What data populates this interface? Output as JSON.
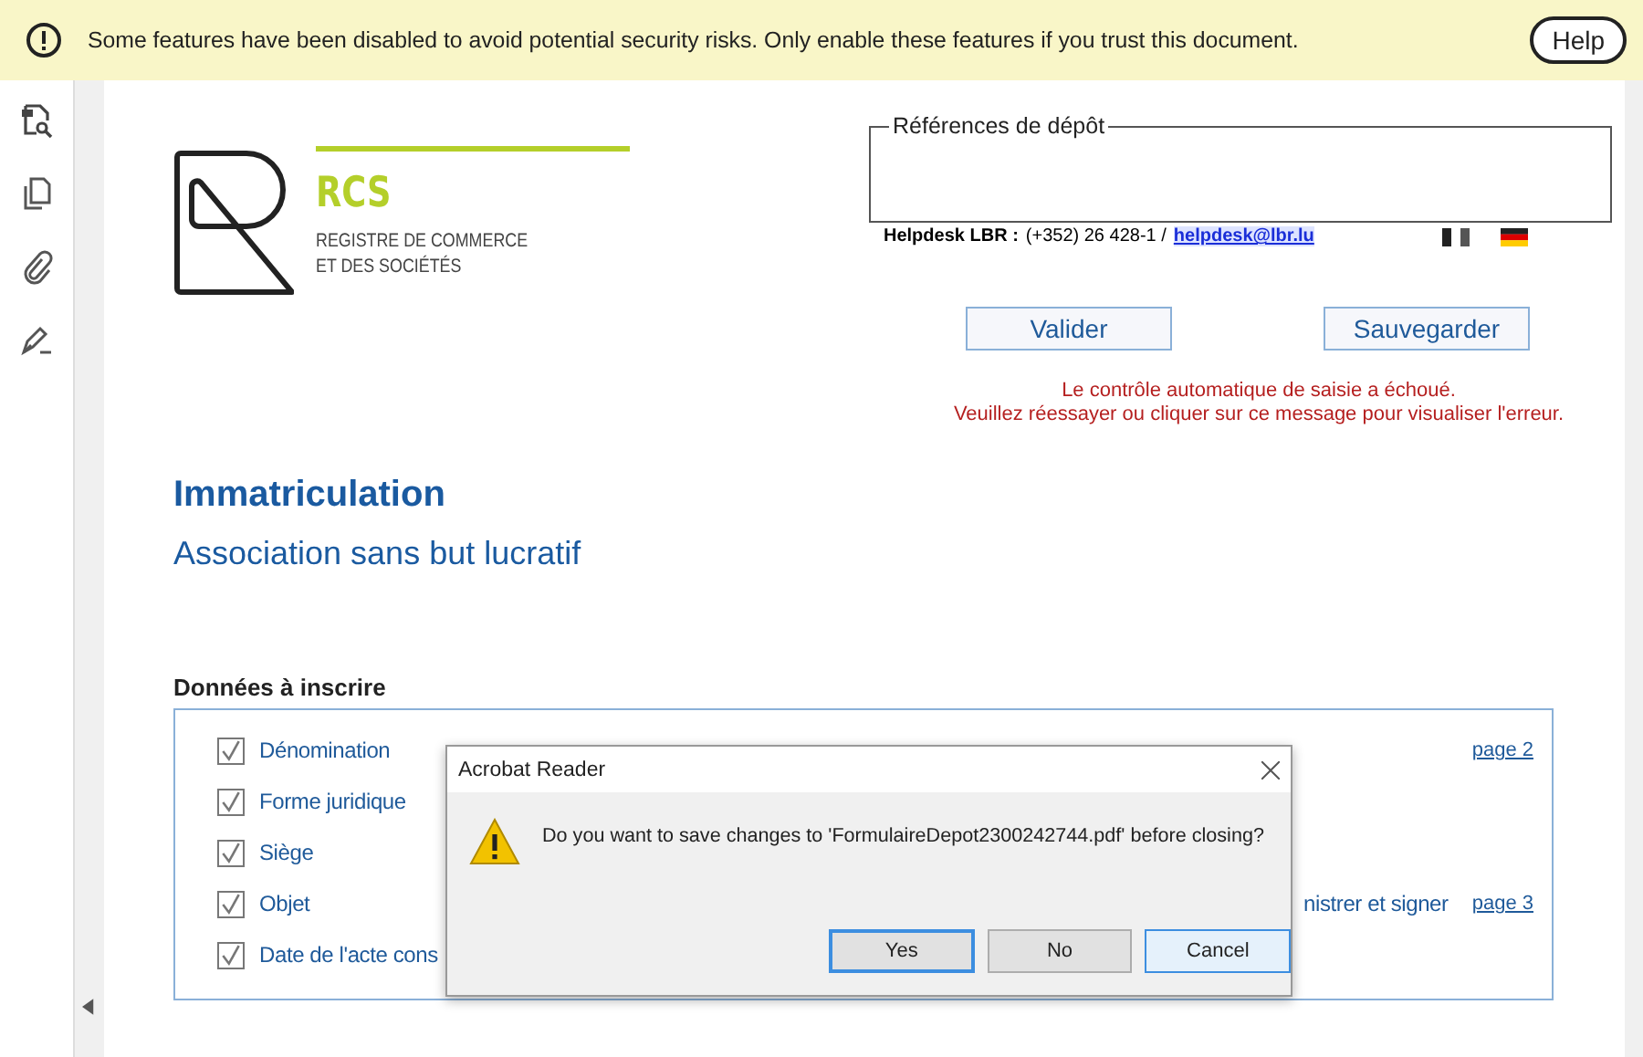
{
  "security_bar": {
    "message": "Some features have been disabled to avoid potential security risks. Only enable these features if you trust this document.",
    "help_button": "Help"
  },
  "document": {
    "logo": {
      "acronym": "RCS",
      "line_1": "REGISTRE DE COMMERCE",
      "line_2": "ET DES SOCIÉTÉS"
    },
    "references": {
      "legend": "Références de dépôt"
    },
    "helpdesk": {
      "label": "Helpdesk LBR :",
      "phone": "(+352) 26 428-1  /",
      "email": "helpdesk@lbr.lu"
    },
    "buttons": [
      "Valider",
      "Sauvegarder"
    ],
    "error_lines": [
      "Le contrôle automatique de saisie a échoué.",
      "Veuillez réessayer ou cliquer sur ce message pour visualiser l'erreur."
    ],
    "title": "Immatriculation",
    "subtitle": "Association sans but lucratif",
    "section": {
      "heading": "Données à inscrire",
      "items": [
        {
          "label": "Dénomination",
          "checked": true,
          "page_link": "page 2"
        },
        {
          "label": "Forme juridique",
          "checked": true
        },
        {
          "label": "Siège",
          "checked": true
        },
        {
          "label": "Objet",
          "checked": true,
          "right_text": "nistrer et signer",
          "page_link": "page 3"
        },
        {
          "label": "Date de l'acte cons",
          "checked": true
        }
      ]
    }
  },
  "dialog": {
    "title": "Acrobat Reader",
    "message": "Do you want to save changes to 'FormulaireDepot2300242744.pdf' before closing?",
    "buttons": [
      {
        "label": "Yes",
        "default": true,
        "highlighted": false
      },
      {
        "label": "No",
        "default": false,
        "highlighted": false
      },
      {
        "label": "Cancel",
        "default": false,
        "highlighted": true
      }
    ]
  }
}
